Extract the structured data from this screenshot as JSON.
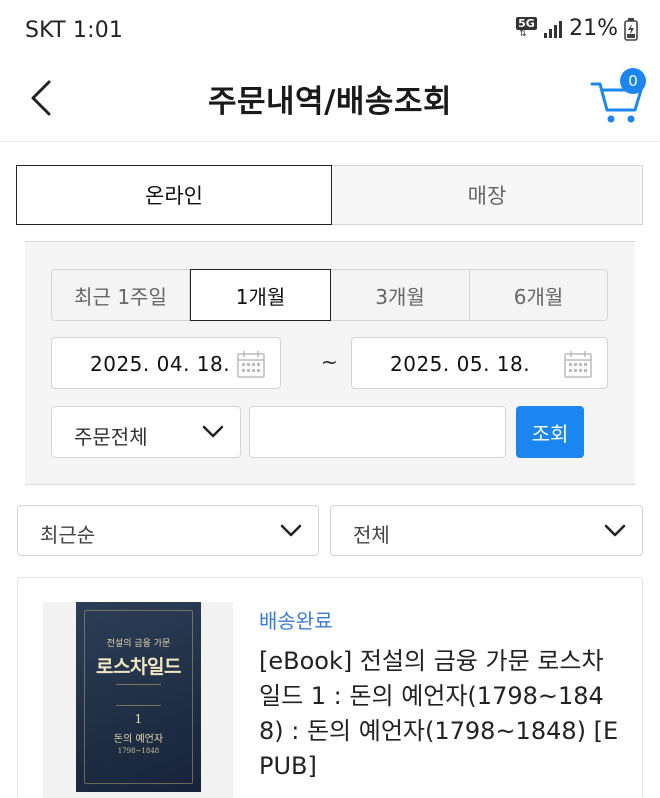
{
  "status_bar": {
    "carrier_time": "SKT 1:01",
    "network": "5G",
    "battery": "21%"
  },
  "header": {
    "title": "주문내역/배송조회",
    "cart_count": "0"
  },
  "channel_tabs": {
    "online": "온라인",
    "store": "매장",
    "selected": "온라인"
  },
  "period_tabs": {
    "items": [
      "최근 1주일",
      "1개월",
      "3개월",
      "6개월"
    ],
    "selected": "1개월"
  },
  "date_range": {
    "start": "2025. 04. 18.",
    "separator": "~",
    "end": "2025. 05. 18."
  },
  "order_filter": {
    "type_label": "주문전체",
    "keyword_value": "",
    "search_button": "조회"
  },
  "sort": {
    "order_label": "최근순",
    "status_label": "전체"
  },
  "orders": [
    {
      "status": "배송완료",
      "title": "[eBook] 전설의 금융 가문 로스차일드 1 : 돈의 예언자(1798~1848) : 돈의 예언자(1798~1848) [EPUB]",
      "cover": {
        "subtitle": "전설의 금융 가문",
        "title": "로스차일드",
        "volume": "1",
        "volume_title": "돈의 예언자",
        "years": "1798~1848"
      }
    }
  ],
  "colors": {
    "accent": "#1b86f0",
    "status_text": "#3a7bd5"
  }
}
